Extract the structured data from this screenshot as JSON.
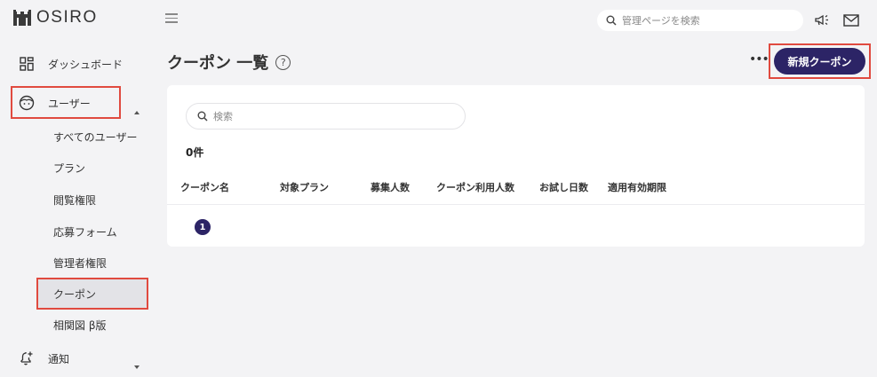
{
  "brand": {
    "name": "OSIRO"
  },
  "header": {
    "search_placeholder": "管理ページを検索",
    "icons": [
      "megaphone-icon",
      "mail-icon"
    ]
  },
  "sidebar": {
    "dashboard": "ダッシュボード",
    "users": "ユーザー",
    "users_children": [
      "すべてのユーザー",
      "プラン",
      "閲覧権限",
      "応募フォーム",
      "管理者権限",
      "クーポン",
      "相関図 β版"
    ],
    "notifications": "通知",
    "active_item": "クーポン"
  },
  "page": {
    "title": "クーポン 一覧",
    "more_label": "•••",
    "new_button": "新規クーポン"
  },
  "table": {
    "search_placeholder": "検索",
    "count": "0件",
    "columns": [
      "クーポン名",
      "対象プラン",
      "募集人数",
      "クーポン利用人数",
      "お試し日数",
      "適用有効期限"
    ],
    "rows": [],
    "current_page": "1"
  },
  "colors": {
    "accent": "#2c2466",
    "highlight": "#e04a3f",
    "background": "#f3f3f5"
  }
}
